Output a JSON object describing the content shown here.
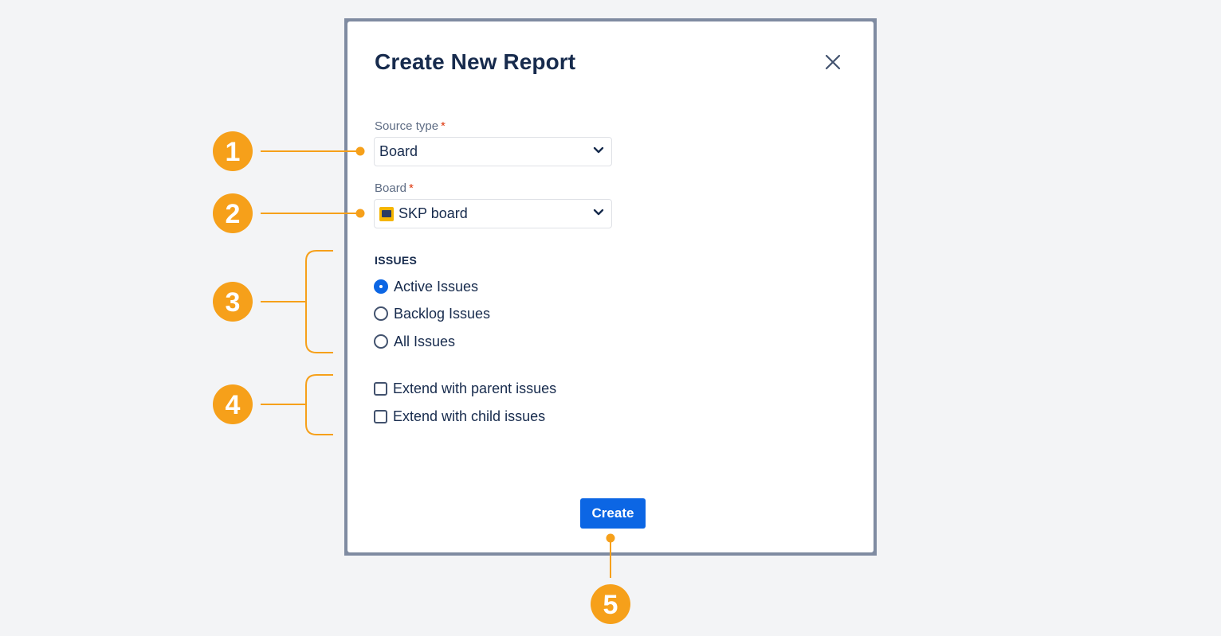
{
  "dialog": {
    "title": "Create New Report",
    "close_icon": "close-icon"
  },
  "source_type": {
    "label": "Source type",
    "required_marker": "*",
    "value": "Board",
    "chevron_icon": "chevron-down-icon"
  },
  "board": {
    "label": "Board",
    "required_marker": "*",
    "value": "SKP board",
    "board_icon": "board-icon",
    "chevron_icon": "chevron-down-icon"
  },
  "issues": {
    "heading": "ISSUES",
    "options": [
      {
        "label": "Active Issues",
        "checked": true
      },
      {
        "label": "Backlog Issues",
        "checked": false
      },
      {
        "label": "All Issues",
        "checked": false
      }
    ]
  },
  "extend": {
    "options": [
      {
        "label": "Extend with parent issues",
        "checked": false
      },
      {
        "label": "Extend with child issues",
        "checked": false
      }
    ]
  },
  "footer": {
    "create_label": "Create"
  },
  "callouts": [
    "1",
    "2",
    "3",
    "4",
    "5"
  ],
  "colors": {
    "accent": "#0c66e4",
    "callout": "#f6a01a",
    "title": "#172b4d",
    "required": "#de350b",
    "frame": "#7f8ba1"
  }
}
